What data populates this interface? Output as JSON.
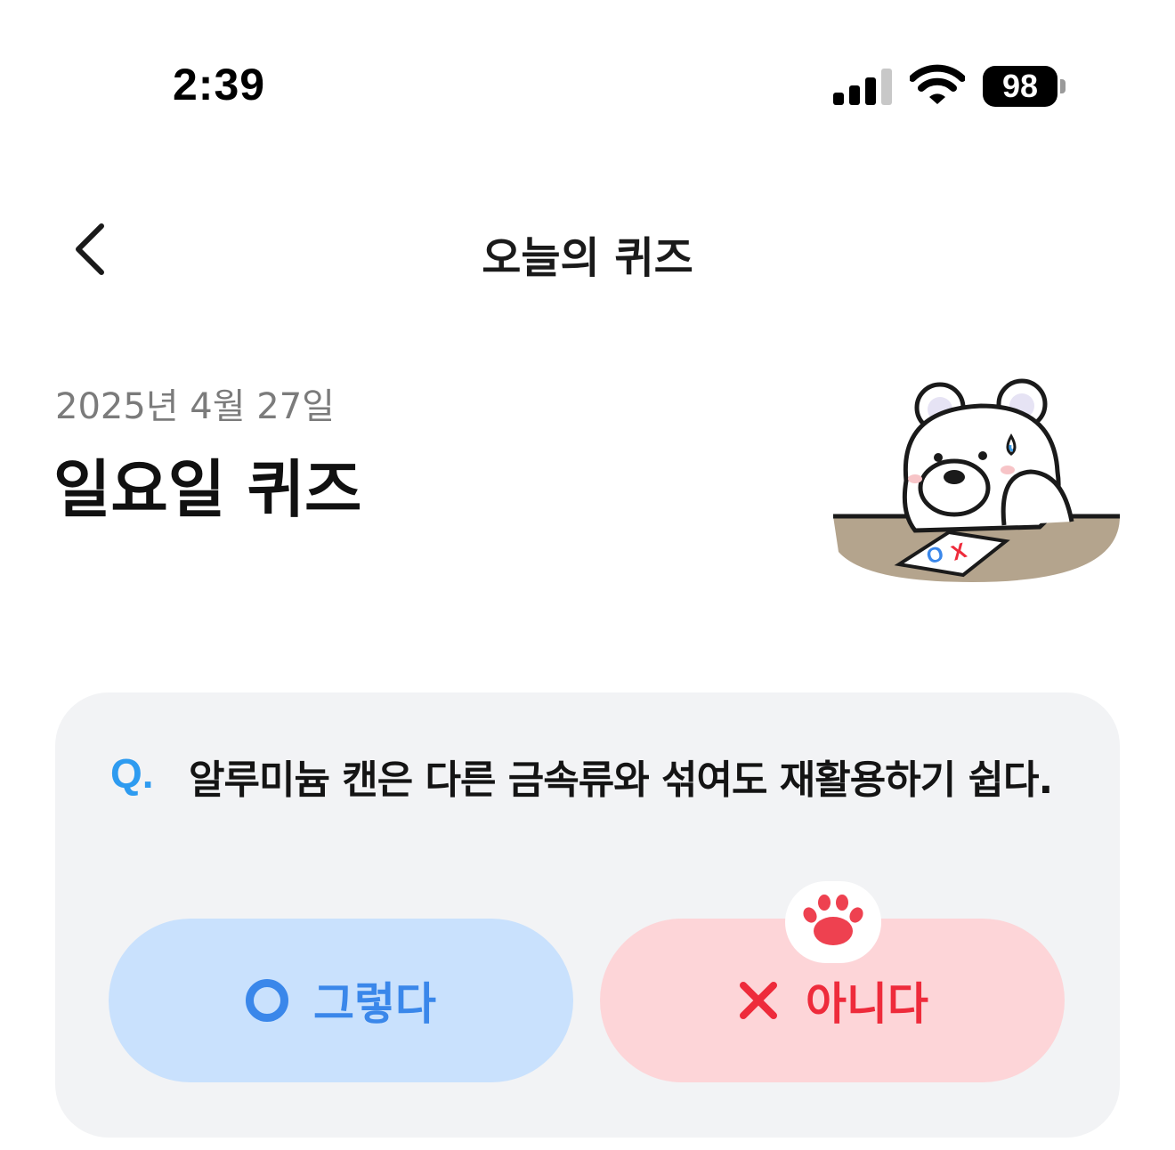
{
  "status_bar": {
    "time": "2:39",
    "battery": "98",
    "icons": [
      "signal-icon",
      "wifi-icon",
      "battery-icon"
    ]
  },
  "header": {
    "title": "오늘의 퀴즈",
    "back_icon": "chevron-left-icon"
  },
  "quiz": {
    "date": "2025년 4월 27일",
    "title": "일요일 퀴즈",
    "question_prefix": "Q.",
    "question": "알루미늄 캔은 다른 금속류와 섞여도 재활용하기 쉽다.",
    "options": {
      "yes_label": "그렇다",
      "no_label": "아니다"
    },
    "selected": "no"
  },
  "colors": {
    "accent_blue": "#3a87ea",
    "accent_red": "#ee2b3b",
    "yes_bg": "#c9e1fd",
    "no_bg": "#fdd5d8",
    "card_bg": "#f2f3f5",
    "q_color": "#2e9bf0"
  }
}
